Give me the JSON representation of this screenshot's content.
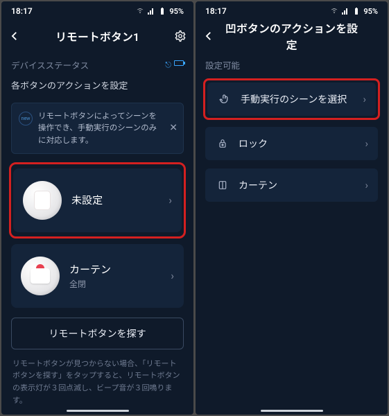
{
  "status_bar": {
    "time": "18:17",
    "battery": "95%"
  },
  "left": {
    "title": "リモートボタン1",
    "device_status_label": "デバイスステータス",
    "section_label": "各ボタンのアクションを設定",
    "info_badge": "new",
    "info_text": "リモートボタンによってシーンを操作でき、手動実行のシーンのみに対応します。",
    "items": [
      {
        "title": "未設定",
        "subtitle": ""
      },
      {
        "title": "カーテン",
        "subtitle": "全閉"
      }
    ],
    "find_button": "リモートボタンを探す",
    "hint": "リモートボタンが見つからない場合、「リモートボタンを探す」をタップすると、リモートボタンの表示灯が３回点滅し、ビープ音が３回鳴ります。"
  },
  "right": {
    "title": "凹ボタンのアクションを設定",
    "section_label": "設定可能",
    "rows": [
      {
        "label": "手動実行のシーンを選択"
      },
      {
        "label": "ロック"
      },
      {
        "label": "カーテン"
      }
    ]
  }
}
